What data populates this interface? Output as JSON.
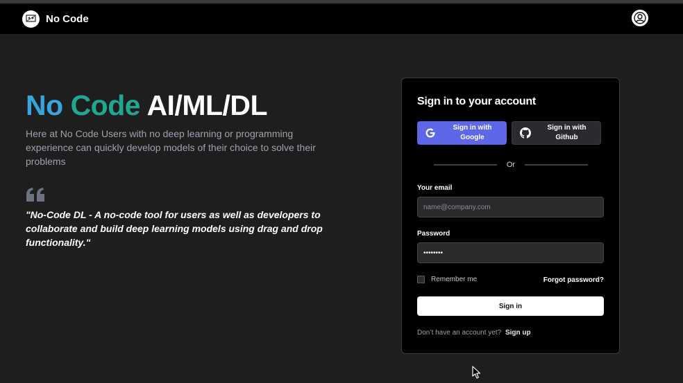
{
  "navbar": {
    "brand": "No Code"
  },
  "hero": {
    "title_part1": "No",
    "title_part2": "Code",
    "title_part3": "AI/ML/DL",
    "description": "Here at No Code Users with no deep learning or programming experience can quickly develop models of their choice to solve their problems",
    "quote": "\"No-Code DL - A no-code tool for users as well as developers to collaborate and build deep learning models using drag and drop functionality.\""
  },
  "signin_card": {
    "title": "Sign in to your account",
    "google_label": "Sign in with Google",
    "github_label": "Sign in with Github",
    "divider_text": "Or",
    "email_label": "Your email",
    "email_placeholder": "name@company.com",
    "password_label": "Password",
    "password_value": "••••••••",
    "remember_label": "Remember me",
    "forgot_label": "Forgot password?",
    "submit_label": "Sign in",
    "signup_prompt": "Don’t have an account yet?",
    "signup_link": "Sign up"
  },
  "colors": {
    "accent_no": "#38a6dd",
    "accent_code": "#1fa88f",
    "google_button": "#5d67e8",
    "background": "#1e1e1e"
  },
  "icons": [
    "logo-icon",
    "user-avatar-icon",
    "quote-icon",
    "google-icon",
    "github-icon",
    "cursor-icon"
  ]
}
